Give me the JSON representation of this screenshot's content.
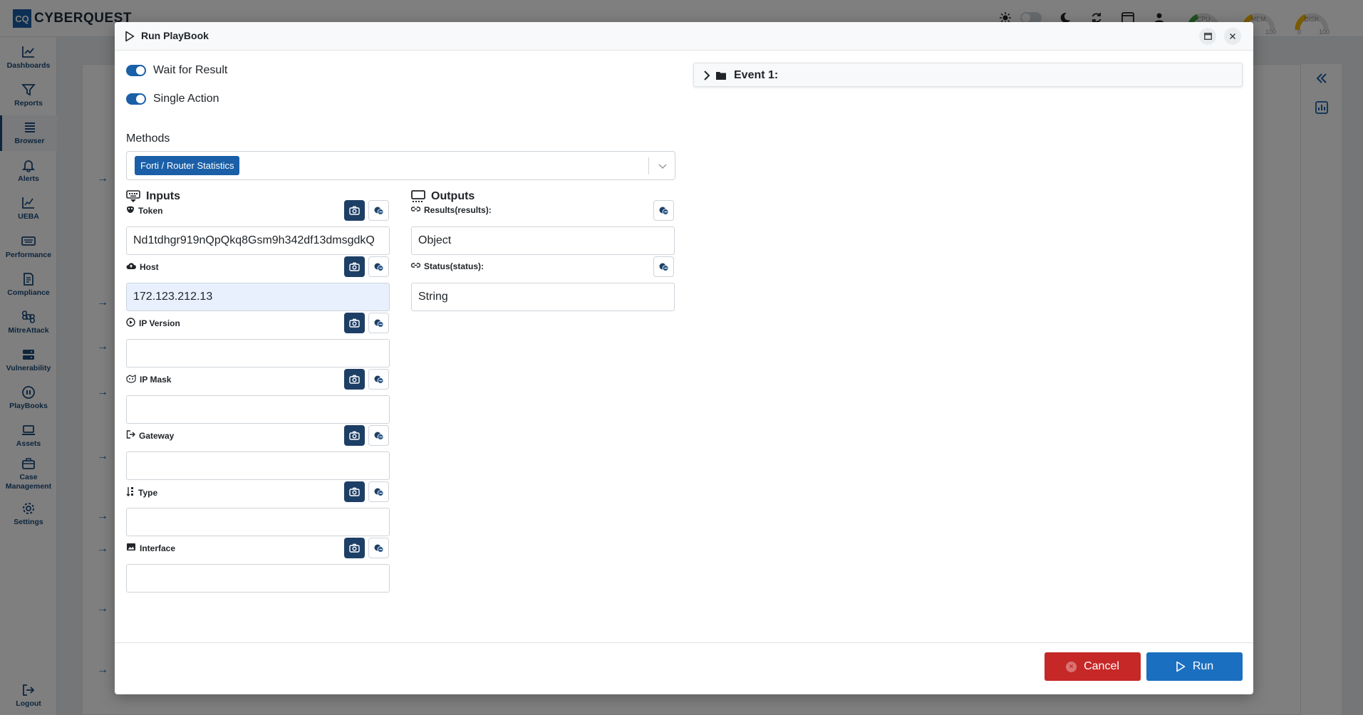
{
  "app": {
    "logo_mark": "CQ",
    "logo_text": "CYBERQUEST"
  },
  "header_gauges": [
    {
      "label": "CPU",
      "min": "",
      "max": "",
      "color": "#43a047"
    },
    {
      "label": "MEM",
      "min": "",
      "max": "100",
      "color": "#f2b705"
    },
    {
      "label": "DISK",
      "min": "0",
      "max": "100",
      "color": "#f2b705"
    }
  ],
  "sidebar": {
    "items": [
      {
        "label": "Dashboards",
        "icon": "chart-line-icon"
      },
      {
        "label": "Reports",
        "icon": "filter-icon"
      },
      {
        "label": "Browser",
        "icon": "list-icon"
      },
      {
        "label": "Alerts",
        "icon": "bell-icon"
      },
      {
        "label": "UEBA",
        "icon": "chart-icon"
      },
      {
        "label": "Performance",
        "icon": "keyboard-icon"
      },
      {
        "label": "Compliance",
        "icon": "document-icon"
      },
      {
        "label": "MitreAttack",
        "icon": "command-icon"
      },
      {
        "label": "Vulnerability",
        "icon": "server-icon"
      },
      {
        "label": "PlayBooks",
        "icon": "playbook-icon"
      },
      {
        "label": "Assets",
        "icon": "laptop-icon"
      },
      {
        "label": "Case Management",
        "icon": "briefcase-icon"
      },
      {
        "label": "Settings",
        "icon": "gear-icon"
      }
    ],
    "logout_label": "Logout"
  },
  "modal": {
    "title": "Run PlayBook",
    "toggles": [
      {
        "label": "Wait for Result",
        "on": true
      },
      {
        "label": "Single Action",
        "on": true
      }
    ],
    "methods": {
      "label": "Methods",
      "selected": "Forti / Router Statistics"
    },
    "inputs": {
      "title": "Inputs",
      "fields": [
        {
          "label": "Token",
          "value": "Nd1tdhgr919nQpQkq8Gsm9h342df13dmsgdkQ",
          "icon": "mask-icon"
        },
        {
          "label": "Host",
          "value": "172.123.212.13",
          "icon": "cloud-icon"
        },
        {
          "label": "IP Version",
          "value": "",
          "icon": "play-circle-icon"
        },
        {
          "label": "IP Mask",
          "value": "",
          "icon": "mask-outline-icon"
        },
        {
          "label": "Gateway",
          "value": "",
          "icon": "exit-icon"
        },
        {
          "label": "Type",
          "value": "",
          "icon": "sort-icon"
        },
        {
          "label": "Interface",
          "value": "",
          "icon": "image-icon"
        }
      ]
    },
    "outputs": {
      "title": "Outputs",
      "fields": [
        {
          "label": "Results(results):",
          "value": "Object",
          "icon": "link-icon"
        },
        {
          "label": "Status(status):",
          "value": "String",
          "icon": "link-icon"
        }
      ]
    },
    "event": {
      "title": "Event 1:"
    },
    "footer": {
      "cancel_label": "Cancel",
      "run_label": "Run"
    }
  },
  "colors": {
    "primary": "#1a5fa8",
    "dark_button": "#1d3f66",
    "cancel": "#c62828",
    "run": "#1a6fc0"
  }
}
